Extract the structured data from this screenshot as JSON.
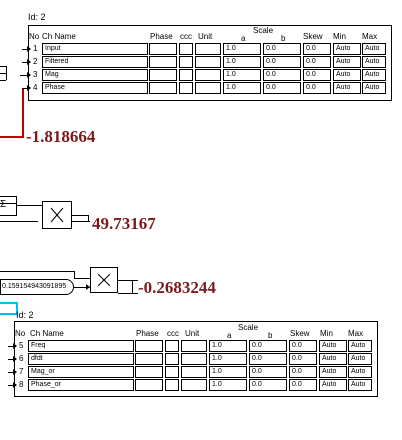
{
  "block1": {
    "id_label": "Id: 2",
    "headers": {
      "no": "No",
      "ch_name": "Ch Name",
      "phase": "Phase",
      "ccc": "ccc",
      "unit": "Unit",
      "scale": "Scale",
      "a": "a",
      "b": "b",
      "skew": "Skew",
      "min": "Min",
      "max": "Max"
    },
    "rows": [
      {
        "no": "1",
        "name": "Input",
        "a": "1.0",
        "b": "0.0",
        "skew": "0.0",
        "min": "Auto",
        "max": "Auto"
      },
      {
        "no": "2",
        "name": "Filtered",
        "a": "1.0",
        "b": "0.0",
        "skew": "0.0",
        "min": "Auto",
        "max": "Auto"
      },
      {
        "no": "3",
        "name": "Mag",
        "a": "1.0",
        "b": "0.0",
        "skew": "0.0",
        "min": "Auto",
        "max": "Auto"
      },
      {
        "no": "4",
        "name": "Phase",
        "a": "1.0",
        "b": "0.0",
        "skew": "0.0",
        "min": "Auto",
        "max": "Auto"
      }
    ]
  },
  "block2": {
    "id_label": "Id: 2",
    "headers": {
      "no": "No",
      "ch_name": "Ch Name",
      "phase": "Phase",
      "ccc": "ccc",
      "unit": "Unit",
      "scale": "Scale",
      "a": "a",
      "b": "b",
      "skew": "Skew",
      "min": "Min",
      "max": "Max"
    },
    "rows": [
      {
        "no": "5",
        "name": "Freq",
        "a": "1.0",
        "b": "0.0",
        "skew": "0.0",
        "min": "Auto",
        "max": "Auto"
      },
      {
        "no": "6",
        "name": "dfdt",
        "a": "1.0",
        "b": "0.0",
        "skew": "0.0",
        "min": "Auto",
        "max": "Auto"
      },
      {
        "no": "7",
        "name": "Mag_or",
        "a": "1.0",
        "b": "0.0",
        "skew": "0.0",
        "min": "Auto",
        "max": "Auto"
      },
      {
        "no": "8",
        "name": "Phase_or",
        "a": "1.0",
        "b": "0.0",
        "skew": "0.0",
        "min": "Auto",
        "max": "Auto"
      }
    ]
  },
  "values": {
    "v1": "-1.818664",
    "v2": "49.73167",
    "v3": "-0.2683244"
  },
  "constant": {
    "text": "0.159154943091895"
  },
  "colors": {
    "value_text": "#7a1a1a",
    "wire_red": "#c00000",
    "highlight": "#00bfff"
  }
}
